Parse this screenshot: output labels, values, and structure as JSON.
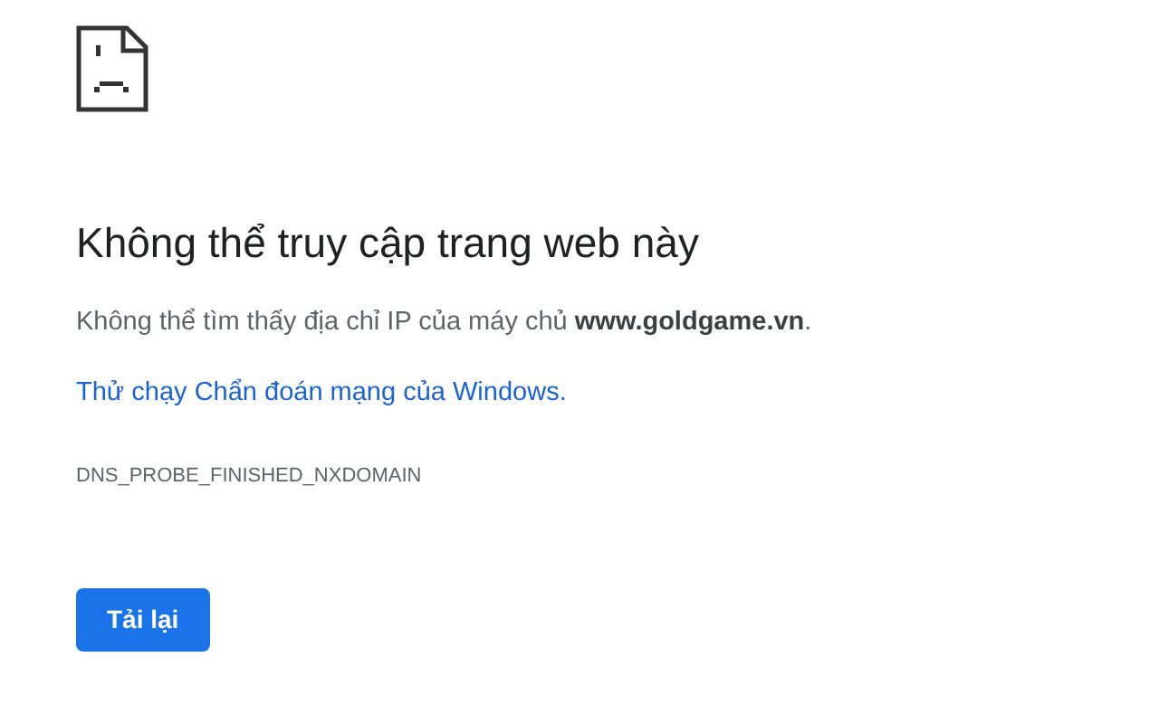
{
  "heading": "Không thể truy cập trang web này",
  "message": "Không thể tìm thấy địa chỉ IP của máy chủ **www.goldgame.vn**.",
  "diagnostics_link": "Thử chạy Chẩn đoán mạng của Windows.",
  "error_code": "DNS_PROBE_FINISHED_NXDOMAIN",
  "buttons": [
    "Tải lại"
  ]
}
